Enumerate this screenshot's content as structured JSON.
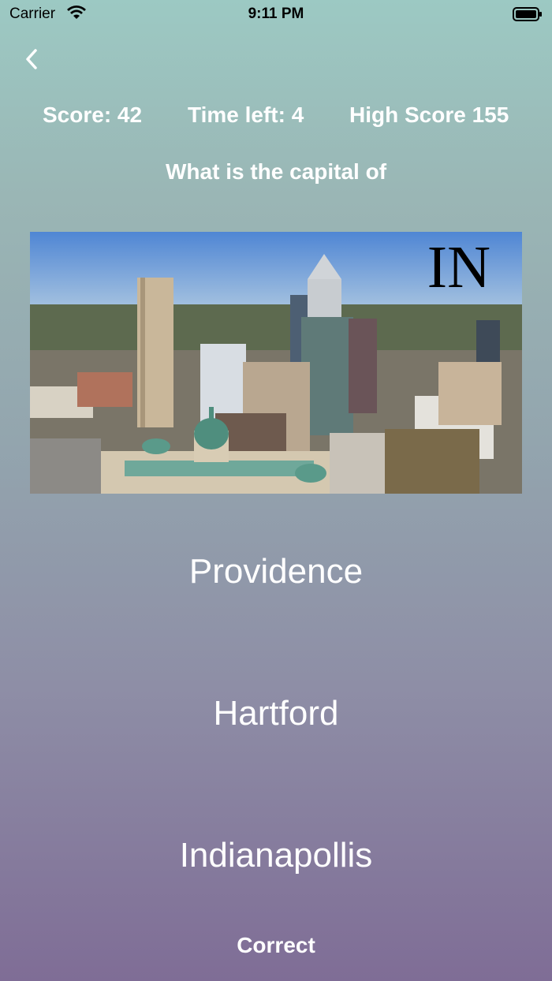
{
  "status_bar": {
    "carrier": "Carrier",
    "time": "9:11 PM"
  },
  "nav": {
    "back_icon": "chevron-left-icon"
  },
  "stats": {
    "score": "Score: 42",
    "time_left": "Time left: 4",
    "high_score": "High Score 155"
  },
  "question": {
    "prompt": "What is the capital of",
    "state_code": "IN"
  },
  "answers": [
    {
      "label": "Providence"
    },
    {
      "label": "Hartford"
    },
    {
      "label": "Indianapollis"
    }
  ],
  "result": {
    "text": "Correct"
  },
  "colors": {
    "text": "#ffffff",
    "background_top": "#9cc9c3",
    "background_bottom": "#7f6d96"
  }
}
